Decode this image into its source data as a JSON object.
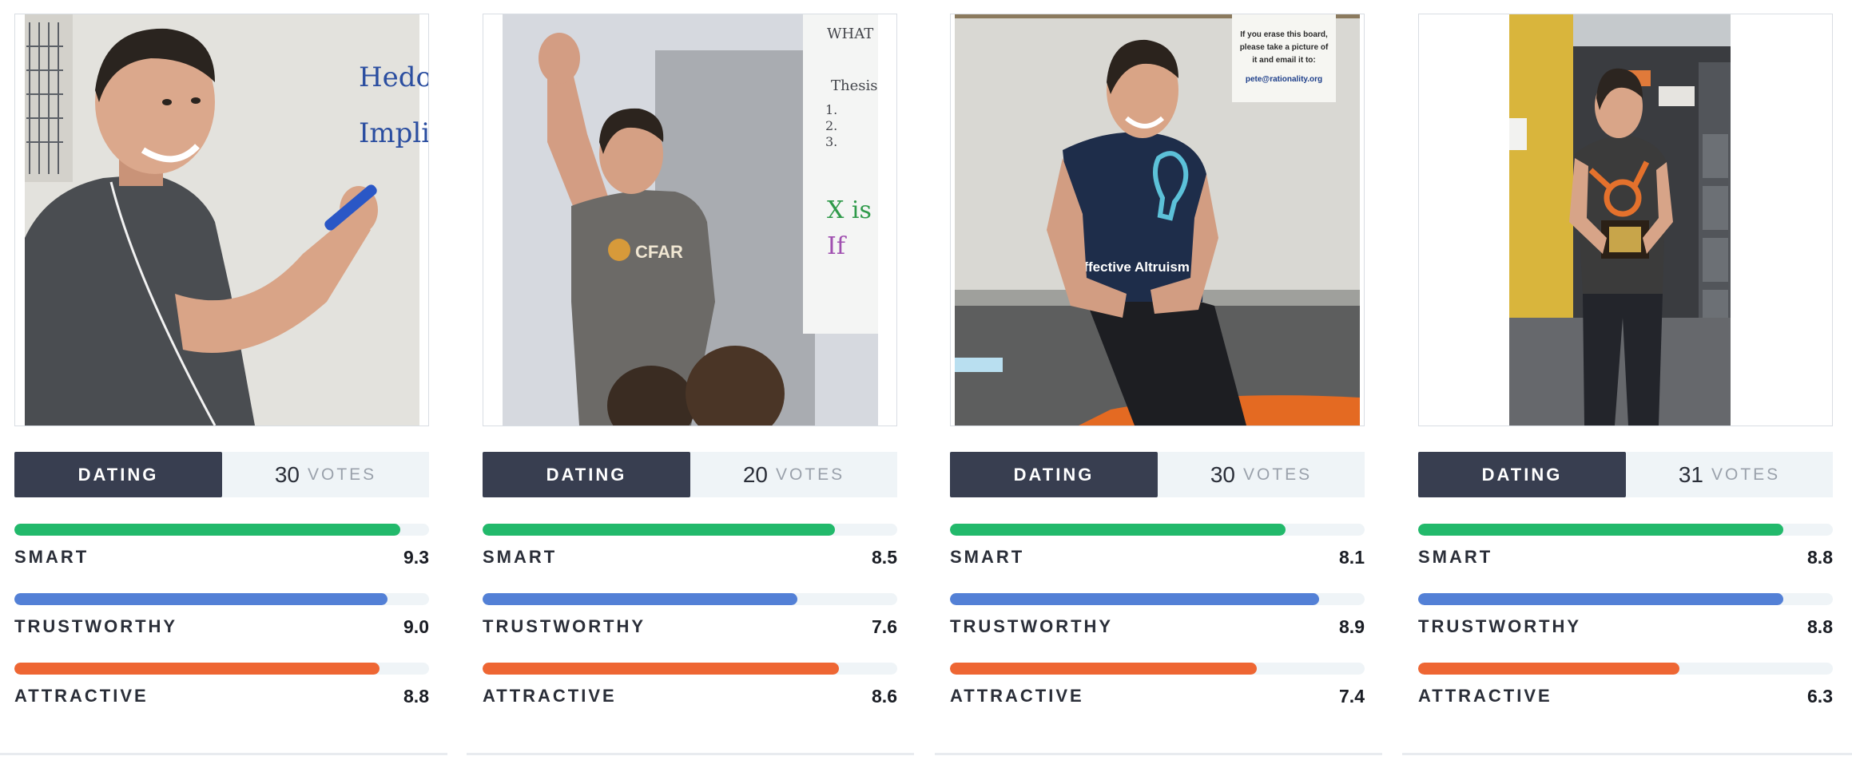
{
  "colors": {
    "smart": "#22b96b",
    "trustworthy": "#5380d6",
    "attractive": "#ee6633",
    "button_bg": "#383e50",
    "track_bg": "#eff4f7"
  },
  "photos": [
    {
      "whiteboard_lines": [
        "Hedon",
        "Impli"
      ]
    },
    {
      "shirt_text": "CFAR",
      "whiteboard_lines": [
        "WHAT",
        "Thesis",
        "1.",
        "2.",
        "3.",
        "X is",
        "If"
      ]
    },
    {
      "shirt_text": "Effective Altruism",
      "sign_lines": [
        "If you erase this board,",
        "please take a picture of",
        "it and email it to:",
        "pete@rationality.org"
      ]
    },
    {}
  ],
  "cards": [
    {
      "category_label": "DATING",
      "votes": "30",
      "votes_label": "VOTES",
      "metrics": [
        {
          "label": "SMART",
          "value": "9.3",
          "score": 9.3
        },
        {
          "label": "TRUSTWORTHY",
          "value": "9.0",
          "score": 9.0
        },
        {
          "label": "ATTRACTIVE",
          "value": "8.8",
          "score": 8.8
        }
      ]
    },
    {
      "category_label": "DATING",
      "votes": "20",
      "votes_label": "VOTES",
      "metrics": [
        {
          "label": "SMART",
          "value": "8.5",
          "score": 8.5
        },
        {
          "label": "TRUSTWORTHY",
          "value": "7.6",
          "score": 7.6
        },
        {
          "label": "ATTRACTIVE",
          "value": "8.6",
          "score": 8.6
        }
      ]
    },
    {
      "category_label": "DATING",
      "votes": "30",
      "votes_label": "VOTES",
      "metrics": [
        {
          "label": "SMART",
          "value": "8.1",
          "score": 8.1
        },
        {
          "label": "TRUSTWORTHY",
          "value": "8.9",
          "score": 8.9
        },
        {
          "label": "ATTRACTIVE",
          "value": "7.4",
          "score": 7.4
        }
      ]
    },
    {
      "category_label": "DATING",
      "votes": "31",
      "votes_label": "VOTES",
      "metrics": [
        {
          "label": "SMART",
          "value": "8.8",
          "score": 8.8
        },
        {
          "label": "TRUSTWORTHY",
          "value": "8.8",
          "score": 8.8
        },
        {
          "label": "ATTRACTIVE",
          "value": "6.3",
          "score": 6.3
        }
      ]
    }
  ]
}
